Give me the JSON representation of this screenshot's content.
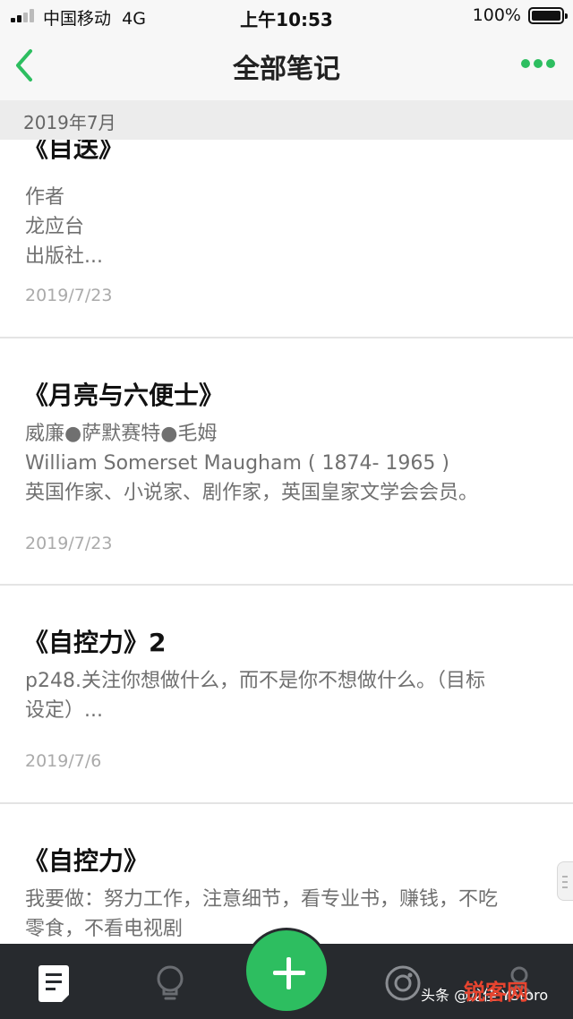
{
  "status_bar": {
    "carrier": "中国移动",
    "network": "4G",
    "time": "上午10:53",
    "battery_percent": "100%"
  },
  "nav": {
    "back_icon": "chevron-left-icon",
    "title": "全部笔记",
    "more_icon": "more-dots-icon",
    "accent_color": "#2dbe60"
  },
  "month_header": "2019年7月",
  "notes": [
    {
      "title": "《目送》",
      "body": [
        "作者",
        "龙应台",
        "出版社..."
      ],
      "date": "2019/7/23"
    },
    {
      "title": "《月亮与六便士》",
      "body": [
        "威廉●萨默赛特●毛姆",
        "William Somerset Maugham ( 1874- 1965 )",
        "英国作家、小说家、剧作家，英国皇家文学会会员。"
      ],
      "date": "2019/7/23"
    },
    {
      "title": "《自控力》2",
      "body": [
        "p248.关注你想做什么，而不是你不想做什么。（目标",
        "设定）..."
      ],
      "date": "2019/7/6"
    },
    {
      "title": "《自控力》",
      "body": [
        "我要做：努力工作，注意细节，看专业书，赚钱，不吃",
        "零食，不看电视剧"
      ],
      "date": ""
    }
  ],
  "tab_bar": {
    "tabs": [
      "notes-tab-icon",
      "lightbulb-icon",
      "add-note-icon",
      "camera-icon",
      "profile-icon"
    ],
    "add_color": "#2dbe60"
  },
  "watermark": {
    "text": "头条 @龙佳 YStoro",
    "logo": "锐客网"
  }
}
